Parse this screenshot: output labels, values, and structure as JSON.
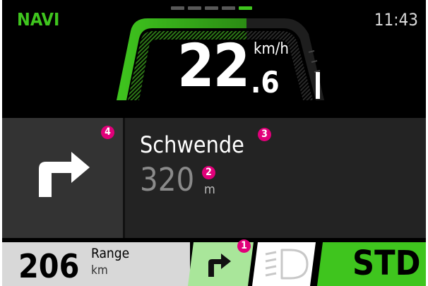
{
  "header": {
    "mode": "NAVI",
    "time": "11:43"
  },
  "page_indicator": {
    "count": 5,
    "active_index": 4
  },
  "speed": {
    "integer": "22",
    "decimal": ".6",
    "unit": "km/h"
  },
  "navigation": {
    "street": "Schwende",
    "distance_value": "320",
    "distance_unit": "m",
    "maneuver_icon": "turn-right-icon"
  },
  "range": {
    "value": "206",
    "label": "Range",
    "unit": "km"
  },
  "bottom_bar": {
    "nav_tile_icon": "turn-right-icon",
    "headlight_icon": "headlight-icon",
    "ride_mode": "STD"
  },
  "badges": {
    "b1": "1",
    "b2": "2",
    "b3": "3",
    "b4": "4"
  },
  "colors": {
    "accent": "#3fc51e",
    "badge": "#e1007a",
    "nav_tile": "#a9e69a",
    "mode_tile": "#3fc51e"
  }
}
